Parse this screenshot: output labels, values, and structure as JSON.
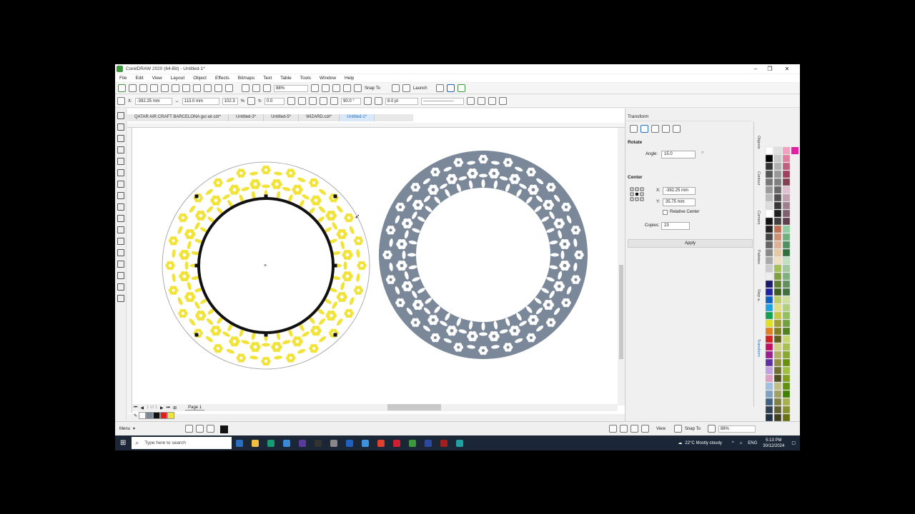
{
  "window": {
    "title": "CorelDRAW 2020 (64-Bit) - Untitled-1*"
  },
  "menu": [
    "File",
    "Edit",
    "View",
    "Layout",
    "Object",
    "Effects",
    "Bitmaps",
    "Text",
    "Table",
    "Tools",
    "Window",
    "Help"
  ],
  "standard_toolbar": {
    "zoom": "88%",
    "snap": "Snap To",
    "launch": "Launch"
  },
  "property_bar": {
    "x": "-392.25 mm",
    "y": "35.75 mm",
    "w": "113.0 mm",
    "h": "113.0 mm",
    "sx": "102.3",
    "sy": "102.3",
    "pct": "%",
    "rot": "0.0",
    "ang1": "90.0 °",
    "ang2": "90.0 °",
    "outline": "8.0 pt"
  },
  "tabs": [
    "QATAR AIR CRAFT BARCELONA gul air.cdr*",
    "Untitled-3*",
    "Untitled-5*",
    "WIZARD.cdr*",
    "Untitled-1*"
  ],
  "active_tab": 4,
  "page_nav": {
    "label": "Page 1"
  },
  "docker": {
    "title": "Transform",
    "rotate_label": "Rotate",
    "angle_label": "Angle:",
    "angle_value": "15.0",
    "center_label": "Center",
    "x_label": "X:",
    "x_value": "-392.25 mm",
    "y_label": "Y:",
    "y_value": "35.75 mm",
    "relative_center": "Relative Center",
    "copies_label": "Copies:",
    "copies_value": "23",
    "apply": "Apply"
  },
  "docker_tabs": [
    "Objects",
    "Contour",
    "Corners",
    "Palettes",
    "Step a..",
    "Transform"
  ],
  "status": {
    "menu": "Menu",
    "view": "View",
    "snap": "Snap To",
    "zoom": "88%"
  },
  "taskbar": {
    "search_placeholder": "Type here to search",
    "weather": "22°C  Mostly cloudy",
    "lang": "ENG",
    "time": "5:13 PM",
    "date": "30/12/2024"
  },
  "colors": {
    "yellow_ring": "#f2e33a",
    "gray_ring": "#7a8899",
    "accent": "#3c9a3c"
  }
}
